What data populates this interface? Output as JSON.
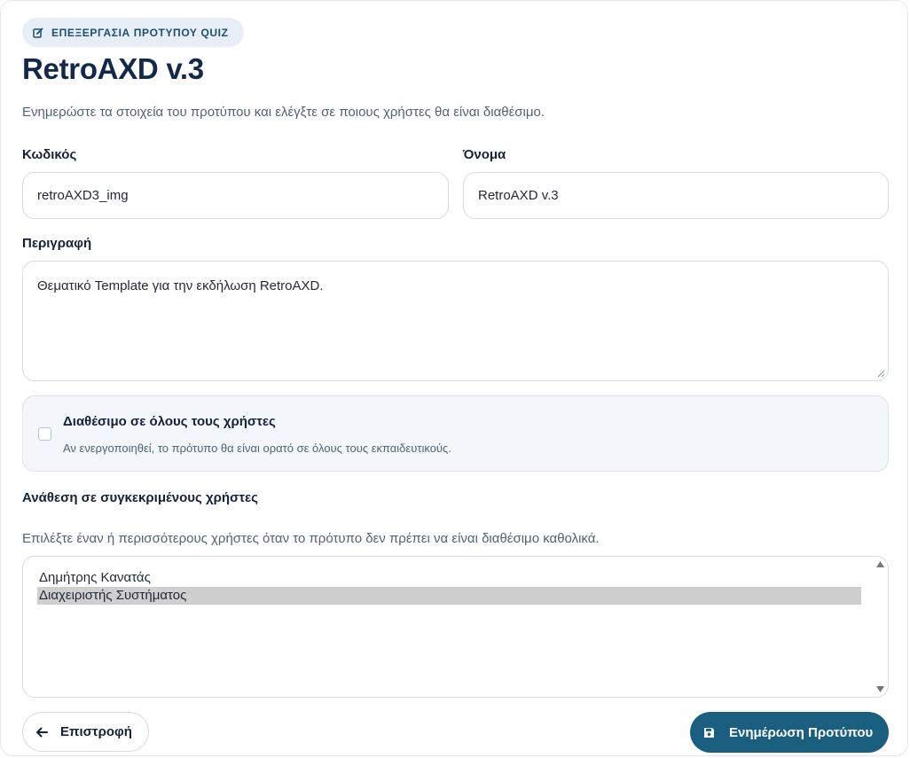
{
  "header": {
    "badge_label": "ΕΠΕΞΕΡΓΑΣΙΑ ΠΡΟΤΥΠΟΥ QUIZ",
    "title": "RetroAXD v.3",
    "subtitle": "Ενημερώστε τα στοιχεία του προτύπου και ελέγξτε σε ποιους χρήστες θα είναι διαθέσιμο."
  },
  "form": {
    "code": {
      "label": "Κωδικός",
      "value": "retroAXD3_img"
    },
    "name": {
      "label": "Όνομα",
      "value": "RetroAXD v.3"
    },
    "description": {
      "label": "Περιγραφή",
      "value": "Θεματικό Template για την εκδήλωση RetroAXD."
    },
    "all_users": {
      "title": "Διαθέσιμο σε όλους τους χρήστες",
      "help": "Αν ενεργοποιηθεί, το πρότυπο θα είναι ορατό σε όλους τους εκπαιδευτικούς.",
      "checked": false
    },
    "assign": {
      "label": "Ανάθεση σε συγκεκριμένους χρήστες",
      "hint": "Επιλέξτε έναν ή περισσότερους χρήστες όταν το πρότυπο δεν πρέπει να είναι διαθέσιμο καθολικά.",
      "options": [
        {
          "label": "Δημήτρης Κανατάς",
          "selected": false
        },
        {
          "label": "Διαχειριστής Συστήματος",
          "selected": true
        }
      ]
    }
  },
  "actions": {
    "back_label": "Επιστροφή",
    "submit_label": "Ενημέρωση Προτύπου"
  },
  "colors": {
    "primary": "#1a5f80",
    "title": "#14294a",
    "badge_bg": "#e7eef5",
    "selected_option": "#cfcfcf"
  },
  "icons": {
    "badge": "edit-icon",
    "back": "arrow-left-icon",
    "submit": "save-icon"
  }
}
